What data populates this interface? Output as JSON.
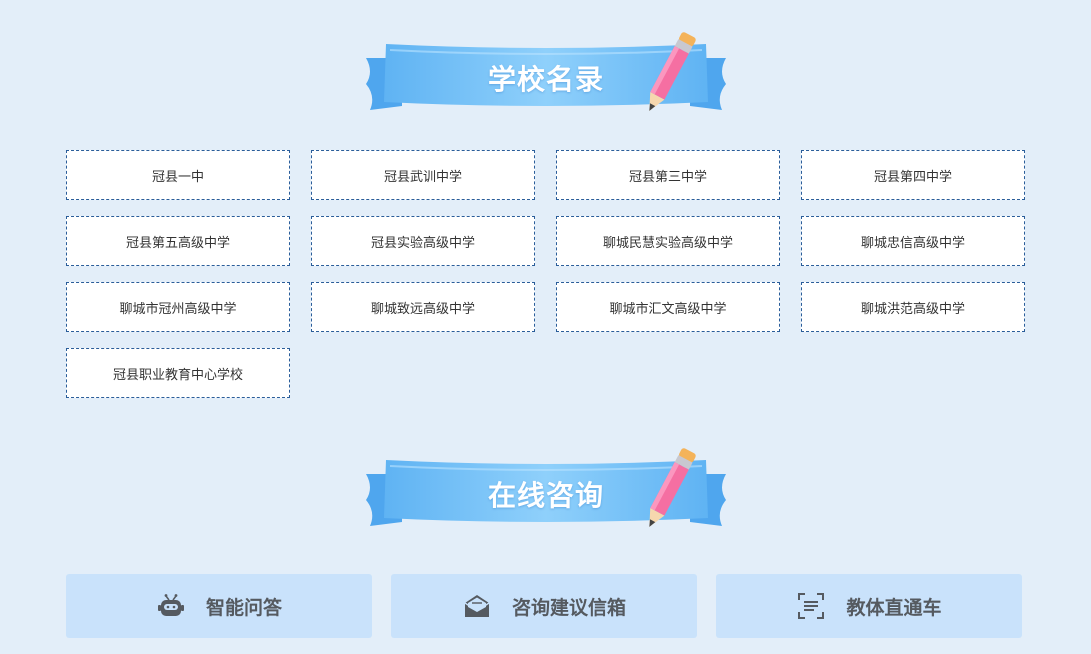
{
  "sections": {
    "schools_title": "学校名录",
    "consult_title": "在线咨询"
  },
  "schools": [
    "冠县一中",
    "冠县武训中学",
    "冠县第三中学",
    "冠县第四中学",
    "冠县第五高级中学",
    "冠县实验高级中学",
    "聊城民慧实验高级中学",
    "聊城忠信高级中学",
    "聊城市冠州高级中学",
    "聊城致远高级中学",
    "聊城市汇文高级中学",
    "聊城洪范高级中学",
    "冠县职业教育中心学校"
  ],
  "consult": [
    {
      "label": "智能问答",
      "icon": "robot-icon"
    },
    {
      "label": "咨询建议信箱",
      "icon": "mailbox-icon"
    },
    {
      "label": "教体直通车",
      "icon": "scan-icon"
    }
  ],
  "colors": {
    "background": "#e3eef9",
    "ribbon": "#7cc3f7",
    "card_border": "#2a5d9a",
    "consult_bg": "#c9e2fb"
  }
}
